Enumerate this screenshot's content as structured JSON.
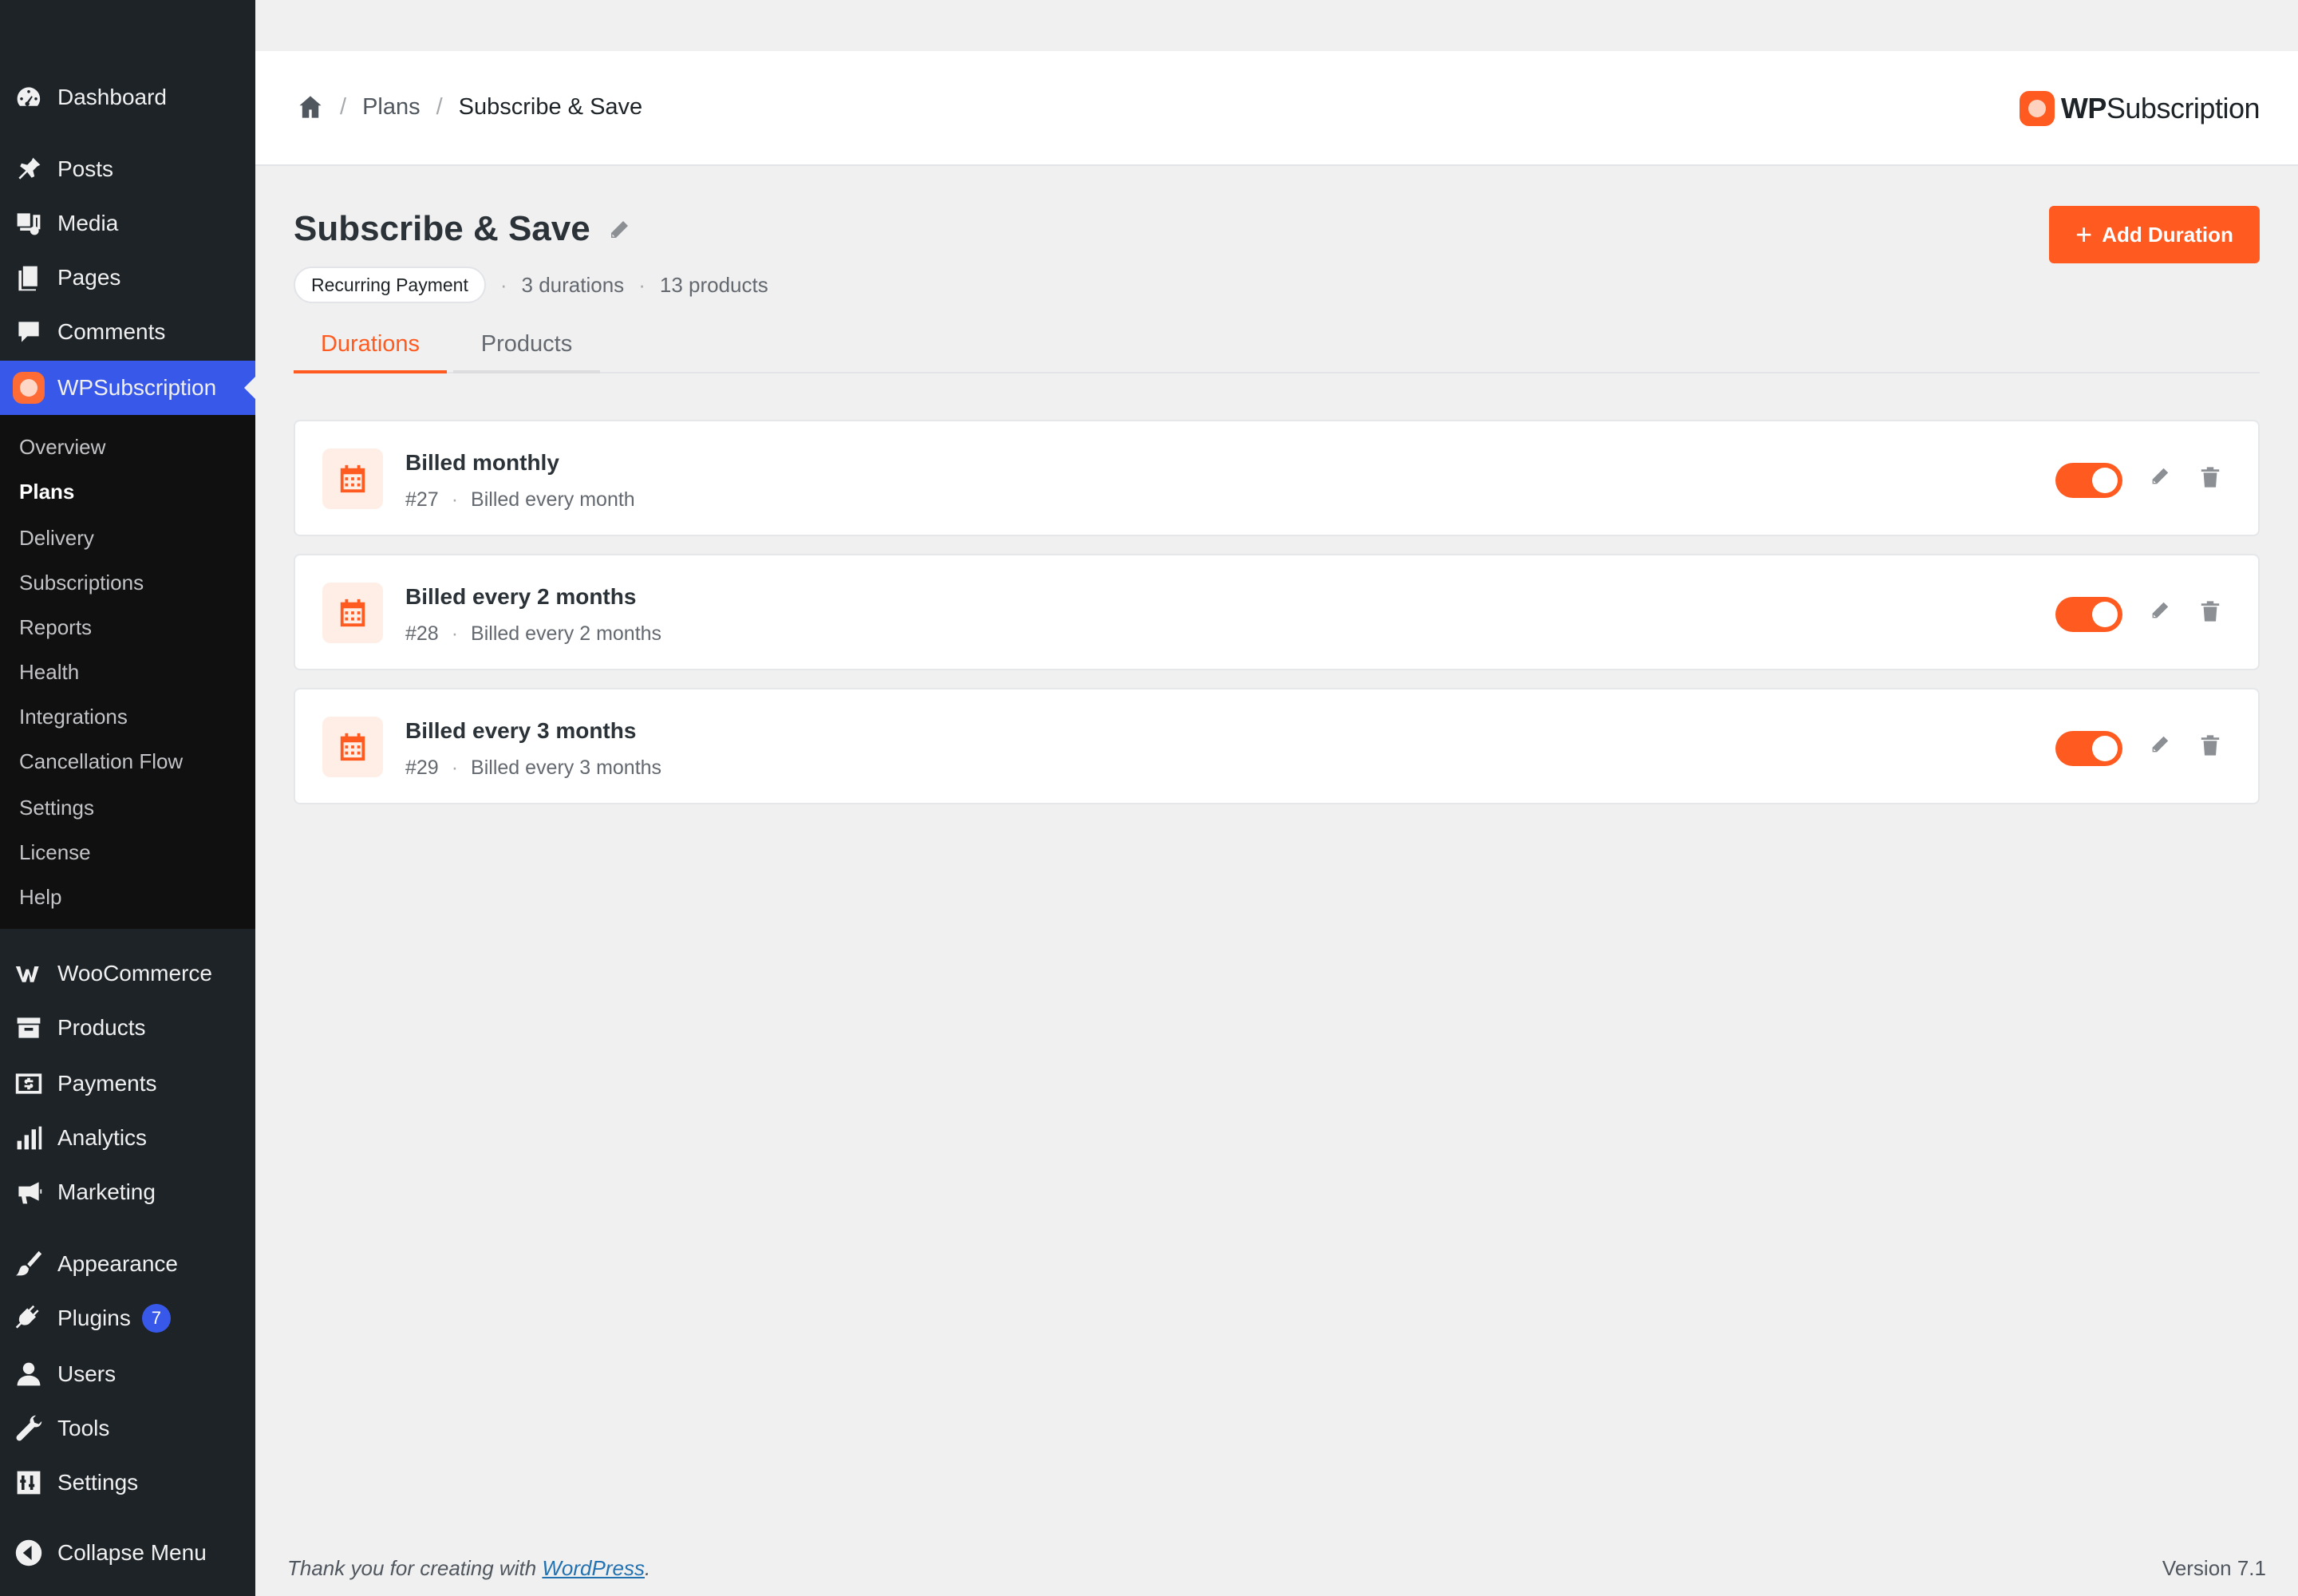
{
  "sidebar": {
    "top_items": [
      {
        "label": "Dashboard",
        "icon": "dashboard-icon"
      },
      {
        "label": "Posts",
        "icon": "pin-icon"
      },
      {
        "label": "Media",
        "icon": "media-icon"
      },
      {
        "label": "Pages",
        "icon": "pages-icon"
      },
      {
        "label": "Comments",
        "icon": "comments-icon"
      },
      {
        "label": "WPSubscription",
        "icon": "wpsubscription-icon"
      }
    ],
    "submenu": [
      {
        "label": "Overview"
      },
      {
        "label": "Plans"
      },
      {
        "label": "Delivery"
      },
      {
        "label": "Subscriptions"
      },
      {
        "label": "Reports"
      },
      {
        "label": "Health"
      },
      {
        "label": "Integrations"
      },
      {
        "label": "Cancellation Flow"
      },
      {
        "label": "Settings"
      },
      {
        "label": "License"
      },
      {
        "label": "Help"
      }
    ],
    "bottom_items": [
      {
        "label": "WooCommerce",
        "icon": "woocommerce-icon"
      },
      {
        "label": "Products",
        "icon": "archive-icon"
      },
      {
        "label": "Payments",
        "icon": "dollar-icon"
      },
      {
        "label": "Analytics",
        "icon": "bar-chart-icon"
      },
      {
        "label": "Marketing",
        "icon": "megaphone-icon"
      },
      {
        "label": "Appearance",
        "icon": "brush-icon"
      },
      {
        "label": "Plugins",
        "icon": "plug-icon",
        "badge": "7"
      },
      {
        "label": "Users",
        "icon": "user-icon"
      },
      {
        "label": "Tools",
        "icon": "wrench-icon"
      },
      {
        "label": "Settings",
        "icon": "sliders-icon"
      },
      {
        "label": "Collapse Menu",
        "icon": "collapse-icon"
      }
    ]
  },
  "header": {
    "breadcrumb": [
      "Plans",
      "Subscribe & Save"
    ],
    "brand_bold": "WP",
    "brand_rest": "Subscription"
  },
  "plan": {
    "title": "Subscribe & Save",
    "type_pill": "Recurring Payment",
    "durations_count": "3 durations",
    "products_count": "13 products",
    "add_button": "Add Duration"
  },
  "tabs": [
    {
      "label": "Durations",
      "active": true
    },
    {
      "label": "Products",
      "active": false
    }
  ],
  "durations": [
    {
      "title": "Billed monthly",
      "id": "#27",
      "desc": "Billed every month",
      "enabled": true
    },
    {
      "title": "Billed every 2 months",
      "id": "#28",
      "desc": "Billed every 2 months",
      "enabled": true
    },
    {
      "title": "Billed every 3 months",
      "id": "#29",
      "desc": "Billed every 3 months",
      "enabled": true
    }
  ],
  "footer": {
    "thanks_prefix": "Thank you for creating with ",
    "thanks_link": "WordPress",
    "thanks_suffix": ".",
    "version": "Version 7.1"
  },
  "colors": {
    "accent": "#ff5a1f",
    "sidebar_bg": "#1d2327",
    "active_menu": "#3858e9"
  }
}
